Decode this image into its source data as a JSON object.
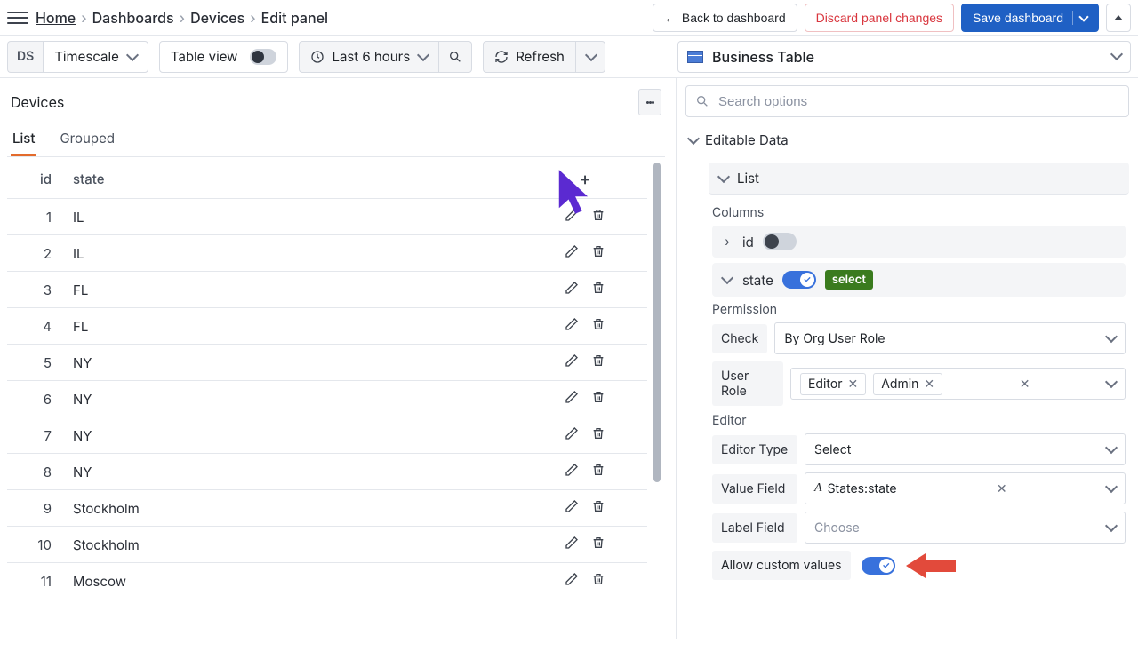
{
  "breadcrumbs": [
    "Home",
    "Dashboards",
    "Devices",
    "Edit panel"
  ],
  "top_buttons": {
    "back": "Back to dashboard",
    "discard": "Discard panel changes",
    "save": "Save dashboard"
  },
  "toolbar": {
    "ds_label": "DS",
    "ds_value": "Timescale",
    "table_view": "Table view",
    "time_range": "Last 6 hours",
    "refresh": "Refresh",
    "panel_type": "Business Table"
  },
  "panel": {
    "title": "Devices",
    "tabs": {
      "list": "List",
      "grouped": "Grouped",
      "active": "list"
    }
  },
  "table": {
    "columns": {
      "id": "id",
      "state": "state"
    },
    "rows": [
      {
        "id": "1",
        "state": "IL"
      },
      {
        "id": "2",
        "state": "IL"
      },
      {
        "id": "3",
        "state": "FL"
      },
      {
        "id": "4",
        "state": "FL"
      },
      {
        "id": "5",
        "state": "NY"
      },
      {
        "id": "6",
        "state": "NY"
      },
      {
        "id": "7",
        "state": "NY"
      },
      {
        "id": "8",
        "state": "NY"
      },
      {
        "id": "9",
        "state": "Stockholm"
      },
      {
        "id": "10",
        "state": "Stockholm"
      },
      {
        "id": "11",
        "state": "Moscow"
      }
    ]
  },
  "options": {
    "search_placeholder": "Search options",
    "section": "Editable Data",
    "layout_item": "List",
    "columns_label": "Columns",
    "col_id": "id",
    "col_state": "state",
    "state_badge": "select",
    "permission_label": "Permission",
    "check_label": "Check",
    "check_value": "By Org User Role",
    "user_role_label": "User Role",
    "roles": [
      "Editor",
      "Admin"
    ],
    "editor_label": "Editor",
    "editor_type_label": "Editor Type",
    "editor_type_value": "Select",
    "value_field_label": "Value Field",
    "value_field_value": "States:state",
    "label_field_label": "Label Field",
    "label_field_value": "Choose",
    "allow_custom_label": "Allow custom values"
  }
}
